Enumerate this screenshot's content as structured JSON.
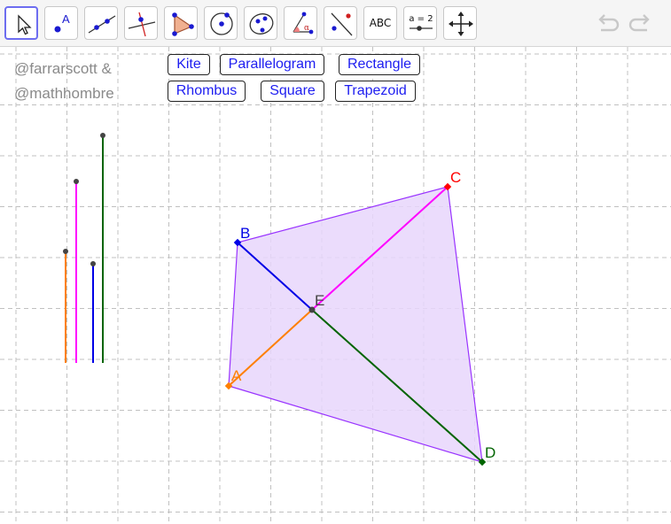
{
  "toolbar": {
    "tools": [
      {
        "name": "move-tool",
        "active": true
      },
      {
        "name": "point-tool",
        "glyph": "A"
      },
      {
        "name": "line-tool"
      },
      {
        "name": "perpendicular-line-tool"
      },
      {
        "name": "polygon-tool"
      },
      {
        "name": "circle-tool"
      },
      {
        "name": "conic-tool"
      },
      {
        "name": "angle-tool",
        "glyph": "α"
      },
      {
        "name": "reflect-tool"
      },
      {
        "name": "text-tool",
        "label": "ABC"
      },
      {
        "name": "slider-tool",
        "label": "a = 2"
      },
      {
        "name": "move-graphics-view-tool"
      }
    ],
    "undo_icon": "undo-arrow-icon",
    "redo_icon": "redo-arrow-icon"
  },
  "credits": {
    "line1": "@farrarscott &",
    "line2": "@mathhombre"
  },
  "buttons": {
    "kite": "Kite",
    "parallelogram": "Parallelogram",
    "rectangle": "Rectangle",
    "rhombus": "Rhombus",
    "square": "Square",
    "trapezoid": "Trapezoid"
  },
  "points": {
    "A": "A",
    "B": "B",
    "C": "C",
    "D": "D",
    "E": "E"
  },
  "colors": {
    "segment_EA": "#ff7f00",
    "segment_EB": "#0000e6",
    "segment_EC": "#ff00ff",
    "segment_ED": "#006400",
    "polygon_fill": "#e8d6fb",
    "polygon_stroke": "#9933ff",
    "grid": "#c0c0c0",
    "button_text": "#1d1df0"
  }
}
